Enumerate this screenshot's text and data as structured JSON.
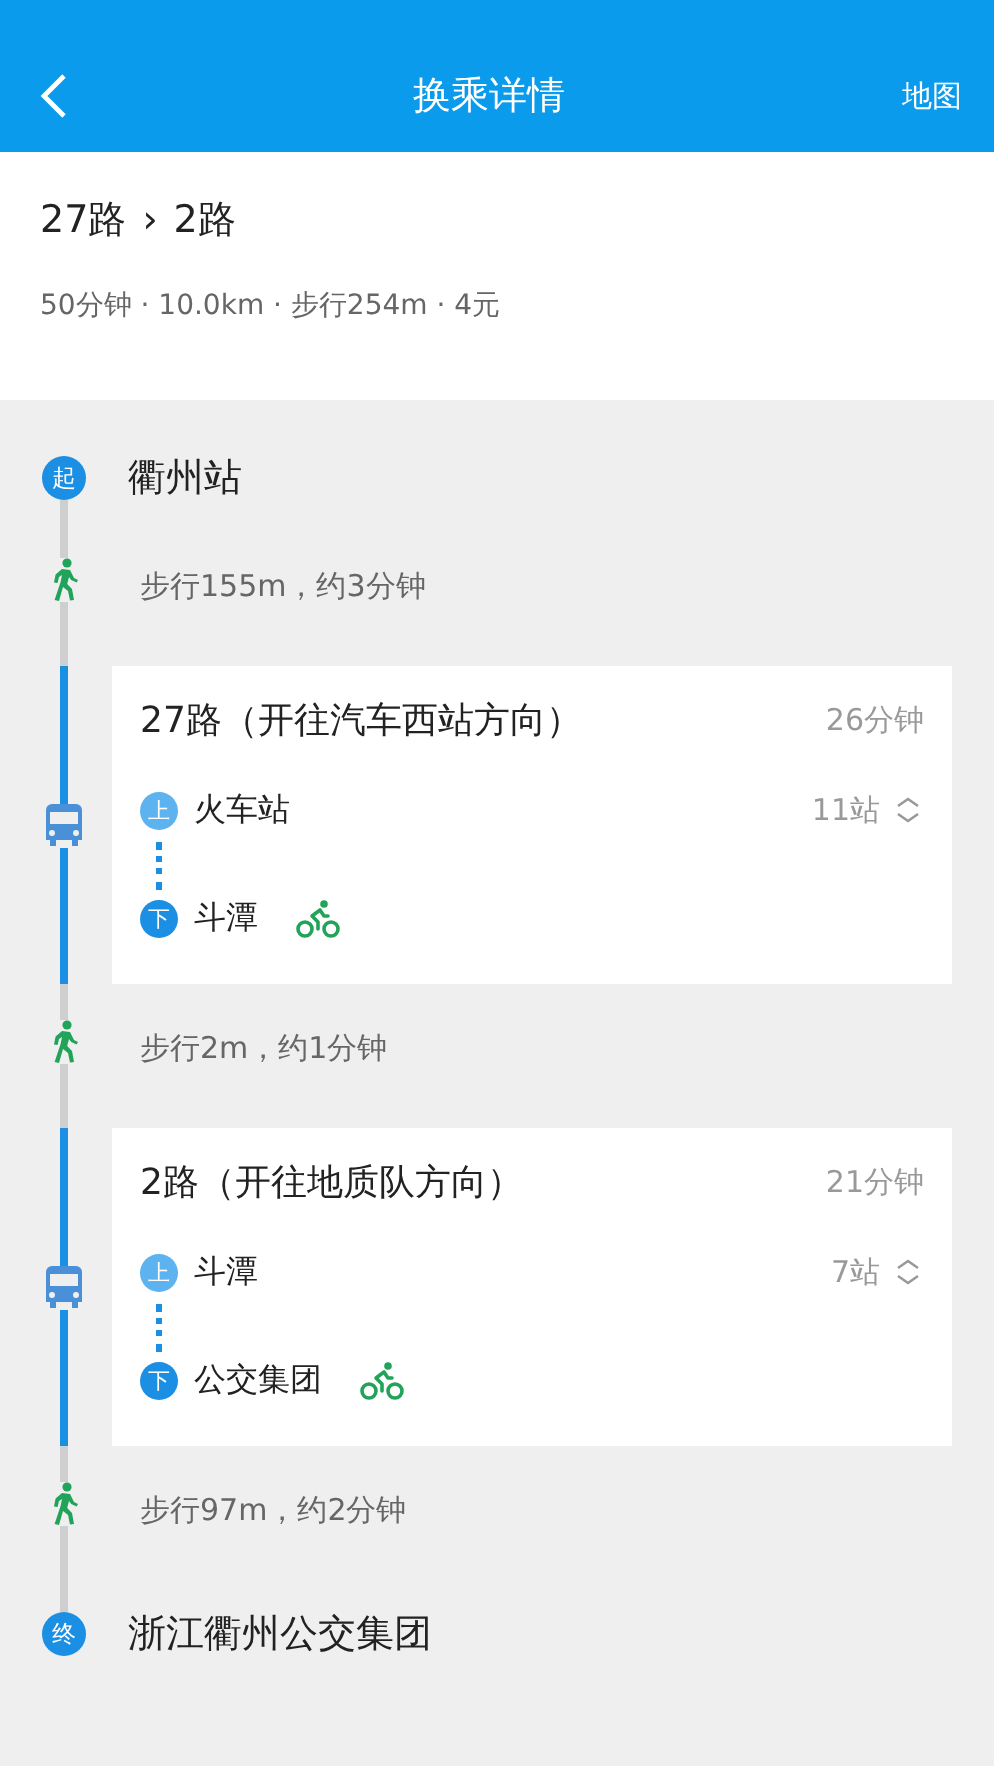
{
  "header": {
    "title": "换乘详情",
    "action": "地图"
  },
  "summary": {
    "routes": [
      "27路",
      "2路"
    ],
    "separator": "›",
    "meta": "50分钟 · 10.0km · 步行254m · 4元"
  },
  "steps": [
    {
      "kind": "endpoint",
      "badge": "起",
      "name": "衢州站"
    },
    {
      "kind": "walk",
      "text": "步行155m，约3分钟"
    },
    {
      "kind": "bus",
      "line": "27路（开往汽车西站方向）",
      "duration": "26分钟",
      "stops": [
        {
          "kind": "board",
          "badge": "上",
          "name": "火车站",
          "count": "11站",
          "bike": false
        },
        {
          "kind": "alight",
          "badge": "下",
          "name": "斗潭",
          "bike": true
        }
      ]
    },
    {
      "kind": "walk",
      "text": "步行2m，约1分钟"
    },
    {
      "kind": "bus",
      "line": "2路（开往地质队方向）",
      "duration": "21分钟",
      "stops": [
        {
          "kind": "board",
          "badge": "上",
          "name": "斗潭",
          "count": "7站",
          "bike": false
        },
        {
          "kind": "alight",
          "badge": "下",
          "name": "公交集团",
          "bike": true
        }
      ]
    },
    {
      "kind": "walk",
      "text": "步行97m，约2分钟"
    },
    {
      "kind": "endpoint",
      "badge": "终",
      "name": "浙江衢州公交集团"
    }
  ]
}
